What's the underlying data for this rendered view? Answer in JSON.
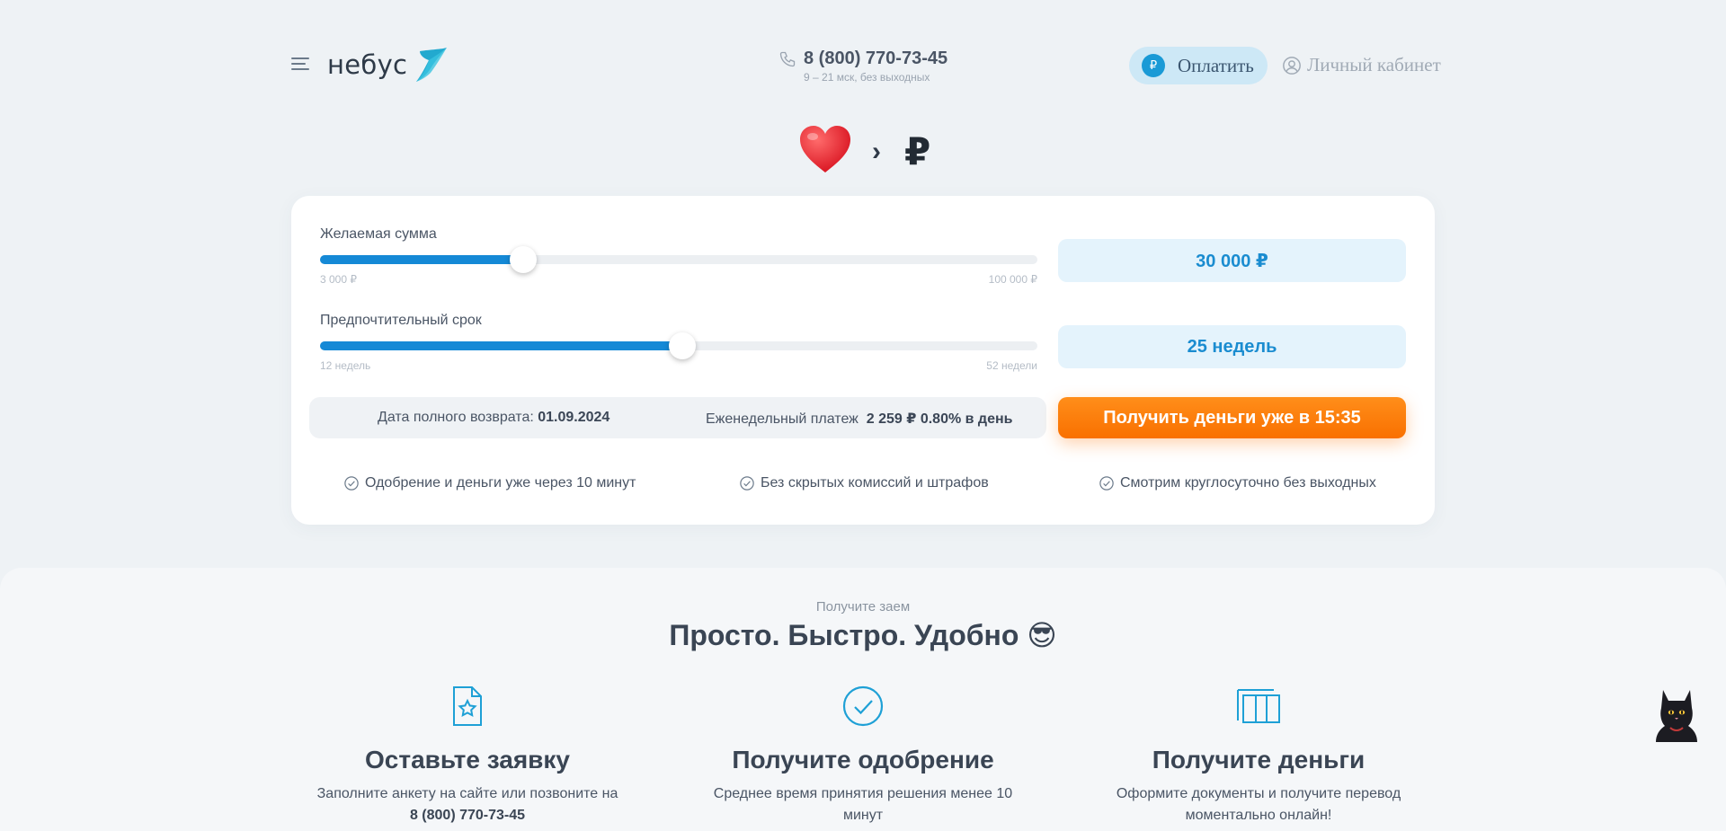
{
  "header": {
    "logo_text": "небус",
    "phone_number": "8 (800) 770-73-45",
    "phone_hours": "9 – 21 мск, без выходных",
    "pay_icon": "₽",
    "pay_label": "Оплатить",
    "cabinet_label": "Личный кабинет"
  },
  "hero": {
    "arrow": "›",
    "currency": "₽"
  },
  "calculator": {
    "amount": {
      "label": "Желаемая сумма",
      "min_label": "3 000 ₽",
      "max_label": "100 000 ₽",
      "value_display": "30 000 ₽",
      "fraction": 0.283
    },
    "term": {
      "label": "Предпочтительный срок",
      "min_label": "12 недель",
      "max_label": "52 недели",
      "value_display": "25 недель",
      "fraction": 0.505
    },
    "return_label": "Дата полного возврата:",
    "return_date": "01.09.2024",
    "payment_label": "Еженедельный платеж",
    "payment_value": "2 259 ₽ 0.80% в день",
    "cta_label": "Получить деньги уже в 15:35"
  },
  "features": [
    {
      "icon": "check-circle-icon",
      "text": "Одобрение и деньги уже через 10 минут"
    },
    {
      "icon": "check-circle-icon",
      "text": "Без скрытых комиссий и штрафов"
    },
    {
      "icon": "check-circle-icon",
      "text": "Смотрим круглосуточно без выходных"
    }
  ],
  "steps_section": {
    "subtitle": "Получите заем",
    "title": "Просто. Быстро. Удобно 😎",
    "steps": [
      {
        "icon": "document-star-icon",
        "title": "Оставьте заявку",
        "text": "Заполните анкету на сайте или позвоните на",
        "phone": "8 (800) 770-73-45"
      },
      {
        "icon": "check-circle-icon",
        "title": "Получите одобрение",
        "text": "Среднее время принятия решения менее 10 минут"
      },
      {
        "icon": "money-icon",
        "title": "Получите деньги",
        "text": "Оформите документы и получите перевод моментально онлайн!"
      }
    ]
  },
  "colors": {
    "accent": "#1589d6",
    "cta": "#f97000",
    "background": "#eef2f5"
  }
}
